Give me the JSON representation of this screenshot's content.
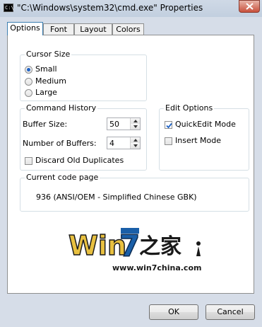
{
  "window": {
    "title": "\"C:\\Windows\\system32\\cmd.exe\" Properties",
    "icon": "cmd-icon",
    "icon_text": "C:\\"
  },
  "tabs": [
    {
      "label": "Options",
      "active": true
    },
    {
      "label": "Font",
      "active": false
    },
    {
      "label": "Layout",
      "active": false
    },
    {
      "label": "Colors",
      "active": false
    }
  ],
  "cursor_size": {
    "label": "Cursor Size",
    "options": [
      {
        "label": "Small",
        "selected": true
      },
      {
        "label": "Medium",
        "selected": false
      },
      {
        "label": "Large",
        "selected": false
      }
    ]
  },
  "command_history": {
    "label": "Command History",
    "buffer_size_label": "Buffer Size:",
    "buffer_size_value": "50",
    "num_buffers_label": "Number of Buffers:",
    "num_buffers_value": "4",
    "discard_label": "Discard Old Duplicates",
    "discard_checked": false
  },
  "edit_options": {
    "label": "Edit Options",
    "quickedit_label": "QuickEdit Mode",
    "quickedit_checked": true,
    "insert_label": "Insert Mode",
    "insert_checked": false
  },
  "code_page": {
    "label": "Current code page",
    "value": "936   (ANSI/OEM - Simplified Chinese GBK)"
  },
  "watermark": {
    "text": "Win7之家",
    "url": "www.win7china.com"
  },
  "buttons": {
    "ok": "OK",
    "cancel": "Cancel"
  },
  "colors": {
    "accent": "#1f63c6",
    "frame": "#d6dde8"
  }
}
